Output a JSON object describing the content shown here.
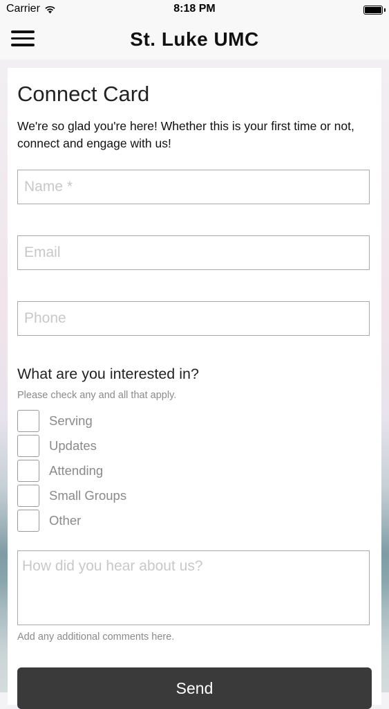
{
  "status_bar": {
    "carrier": "Carrier",
    "time": "8:18 PM"
  },
  "header": {
    "title": "St. Luke UMC"
  },
  "form": {
    "title": "Connect Card",
    "intro": "We're so glad you're here! Whether this is your first time or not, connect and engage with us!",
    "name_placeholder": "Name *",
    "email_placeholder": "Email",
    "phone_placeholder": "Phone",
    "interests_title": "What are you interested in?",
    "interests_hint": "Please check any and all that apply.",
    "interests": [
      {
        "label": "Serving",
        "checked": false
      },
      {
        "label": "Updates",
        "checked": false
      },
      {
        "label": "Attending",
        "checked": false
      },
      {
        "label": "Small Groups",
        "checked": false
      },
      {
        "label": "Other",
        "checked": false
      }
    ],
    "heard_placeholder": "How did you hear about us?",
    "comments_hint": "Add any additional comments here.",
    "send_label": "Send"
  },
  "colors": {
    "button_bg": "#3a3a3a",
    "placeholder": "#c8c8c8",
    "hint_text": "#8a8a8a"
  },
  "icons": {
    "menu": "hamburger-menu-icon",
    "wifi": "wifi-icon",
    "battery": "battery-icon"
  }
}
